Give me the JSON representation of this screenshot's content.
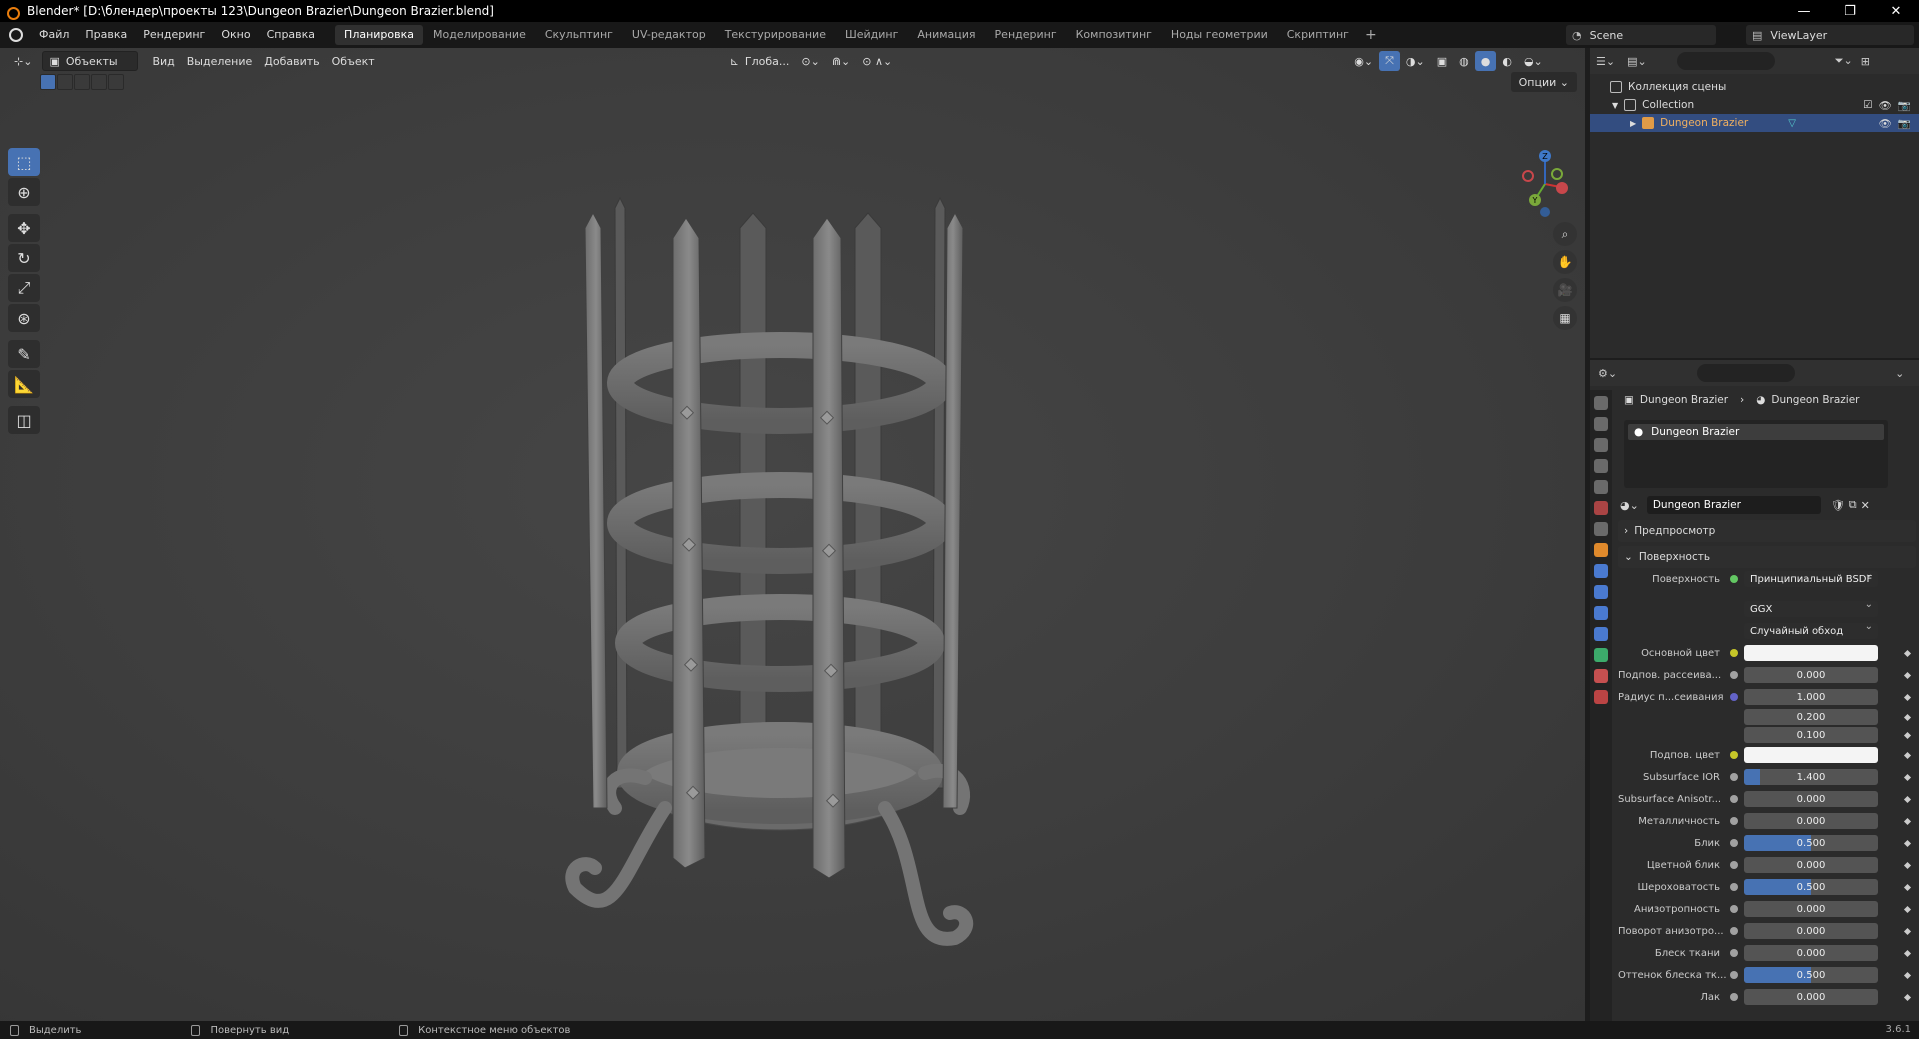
{
  "window": {
    "title": "Blender* [D:\\блендер\\проекты 123\\Dungeon Brazier\\Dungeon Brazier.blend]",
    "min": "—",
    "max": "❐",
    "close": "✕"
  },
  "menu": {
    "items": [
      "Файл",
      "Правка",
      "Рендеринг",
      "Окно",
      "Справка"
    ],
    "workspaces": [
      "Планировка",
      "Моделирование",
      "Скульптинг",
      "UV-редактор",
      "Текстурирование",
      "Шейдинг",
      "Анимация",
      "Рендеринг",
      "Композитинг",
      "Ноды геометрии",
      "Скриптинг"
    ],
    "active_workspace": "Планировка",
    "add": "+"
  },
  "scene": {
    "name": "Scene",
    "view_layer": "ViewLayer"
  },
  "viewport": {
    "mode": "Объекты",
    "menus": [
      "Вид",
      "Выделение",
      "Добавить",
      "Объект"
    ],
    "orientation": "Глоба...",
    "options": "Опции",
    "gizmo": {
      "x": "X",
      "y": "Y",
      "z": "Z"
    }
  },
  "outliner": {
    "root": "Коллекция сцены",
    "collection": "Collection",
    "object": "Dungeon Brazier"
  },
  "properties": {
    "crumb_object": "Dungeon Brazier",
    "crumb_material": "Dungeon Brazier",
    "slot": "Dungeon Brazier",
    "material_name": "Dungeon Brazier",
    "preview_panel": "Предпросмотр",
    "surface_panel": "Поверхность",
    "surface_label": "Поверхность",
    "surface_value": "Принципиальный BSDF",
    "distribution": "GGX",
    "subsurface_method": "Случайный обход",
    "rows": [
      {
        "label": "Основной цвет",
        "value": "",
        "type": "color",
        "dot": "y"
      },
      {
        "label": "Подпов. рассеива...",
        "value": "0.000",
        "fill": 0,
        "dot": "g"
      },
      {
        "label": "Радиус п...сеивания",
        "value": "1.000",
        "fill": 0,
        "dot": "b"
      },
      {
        "label": "",
        "value": "0.200",
        "fill": 0,
        "dot": ""
      },
      {
        "label": "",
        "value": "0.100",
        "fill": 0,
        "dot": ""
      },
      {
        "label": "Подпов. цвет",
        "value": "",
        "type": "color",
        "dot": "y"
      },
      {
        "label": "Subsurface IOR",
        "value": "1.400",
        "fill": 0.12,
        "dot": "g"
      },
      {
        "label": "Subsurface Anisotr...",
        "value": "0.000",
        "fill": 0,
        "dot": "g"
      },
      {
        "label": "Металличность",
        "value": "0.000",
        "fill": 0,
        "dot": "g"
      },
      {
        "label": "Блик",
        "value": "0.500",
        "fill": 0.5,
        "dot": "g"
      },
      {
        "label": "Цветной блик",
        "value": "0.000",
        "fill": 0,
        "dot": "g"
      },
      {
        "label": "Шероховатость",
        "value": "0.500",
        "fill": 0.5,
        "dot": "g"
      },
      {
        "label": "Анизотропность",
        "value": "0.000",
        "fill": 0,
        "dot": "g"
      },
      {
        "label": "Поворот анизотро...",
        "value": "0.000",
        "fill": 0,
        "dot": "g"
      },
      {
        "label": "Блеск ткани",
        "value": "0.000",
        "fill": 0,
        "dot": "g"
      },
      {
        "label": "Оттенок блеска тк...",
        "value": "0.500",
        "fill": 0.5,
        "dot": "g"
      },
      {
        "label": "Лак",
        "value": "0.000",
        "fill": 0,
        "dot": "g"
      }
    ]
  },
  "status": {
    "select": "Выделить",
    "rotate": "Повернуть вид",
    "context": "Контекстное меню объектов",
    "version": "3.6.1"
  },
  "colors": {
    "accent": "#4772b3",
    "selected_row": "#334d80",
    "title_bar": "#000000"
  }
}
